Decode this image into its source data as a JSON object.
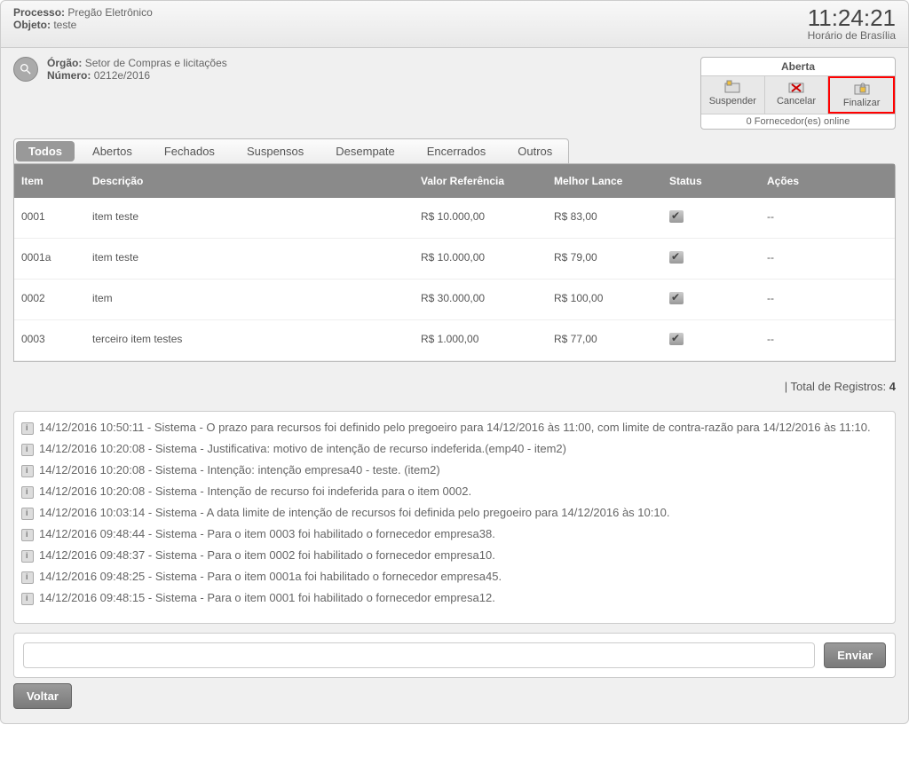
{
  "header": {
    "processo_label": "Processo:",
    "processo_value": "Pregão Eletrônico",
    "objeto_label": "Objeto:",
    "objeto_value": "teste",
    "clock": "11:24:21",
    "timezone": "Horário de Brasília"
  },
  "info": {
    "orgao_label": "Órgão:",
    "orgao_value": "Setor de Compras e licitações",
    "numero_label": "Número:",
    "numero_value": "0212e/2016"
  },
  "status_panel": {
    "title": "Aberta",
    "buttons": {
      "suspender": "Suspender",
      "cancelar": "Cancelar",
      "finalizar": "Finalizar"
    },
    "footer": "0 Fornecedor(es) online"
  },
  "tabs": {
    "todos": "Todos",
    "abertos": "Abertos",
    "fechados": "Fechados",
    "suspensos": "Suspensos",
    "desempate": "Desempate",
    "encerrados": "Encerrados",
    "outros": "Outros"
  },
  "columns": {
    "item": "Item",
    "descricao": "Descrição",
    "valor_ref": "Valor Referência",
    "melhor": "Melhor Lance",
    "status": "Status",
    "acoes": "Ações"
  },
  "rows": [
    {
      "item": "0001",
      "desc": "item teste",
      "ref": "R$ 10.000,00",
      "melhor": "R$ 83,00",
      "acoes": "--"
    },
    {
      "item": "0001a",
      "desc": "item teste",
      "ref": "R$ 10.000,00",
      "melhor": "R$ 79,00",
      "acoes": "--"
    },
    {
      "item": "0002",
      "desc": "item",
      "ref": "R$ 30.000,00",
      "melhor": "R$ 100,00",
      "acoes": "--"
    },
    {
      "item": "0003",
      "desc": "terceiro item testes",
      "ref": "R$ 1.000,00",
      "melhor": "R$ 77,00",
      "acoes": "--"
    }
  ],
  "totals": {
    "label": "| Total de Registros:",
    "value": "4"
  },
  "logs": [
    "14/12/2016 10:50:11 - Sistema - O prazo para recursos foi definido pelo pregoeiro para 14/12/2016 às 11:00, com limite de contra-razão para 14/12/2016 às 11:10.",
    "14/12/2016 10:20:08 - Sistema - Justificativa: motivo de intenção de recurso indeferida.(emp40 - item2)",
    "14/12/2016 10:20:08 - Sistema - Intenção: intenção empresa40 - teste. (item2)",
    "14/12/2016 10:20:08 - Sistema - Intenção de recurso foi indeferida para o item 0002.",
    "14/12/2016 10:03:14 - Sistema - A data limite de intenção de recursos foi definida pelo pregoeiro para 14/12/2016 às 10:10.",
    "14/12/2016 09:48:44 - Sistema - Para o item 0003 foi habilitado o fornecedor empresa38.",
    "14/12/2016 09:48:37 - Sistema - Para o item 0002 foi habilitado o fornecedor empresa10.",
    "14/12/2016 09:48:25 - Sistema - Para o item 0001a foi habilitado o fornecedor empresa45.",
    "14/12/2016 09:48:15 - Sistema - Para o item 0001 foi habilitado o fornecedor empresa12."
  ],
  "chat": {
    "send": "Enviar",
    "placeholder": ""
  },
  "back": "Voltar"
}
